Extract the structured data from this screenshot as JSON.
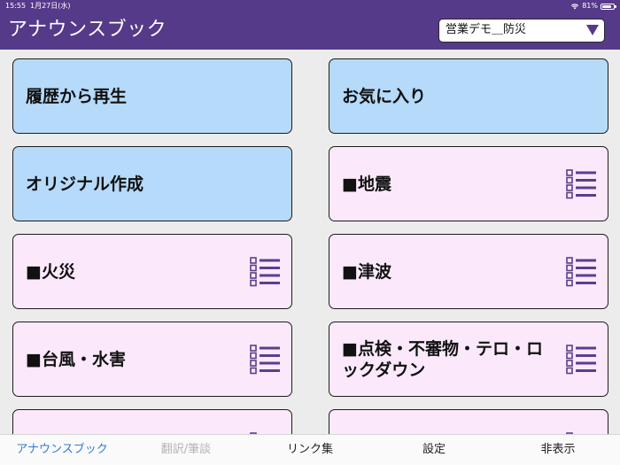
{
  "status_bar": {
    "time": "15:55",
    "date": "1月27日(水)",
    "battery_percent": "81%",
    "battery_level": 0.81
  },
  "header": {
    "title": "アナウンスブック",
    "scenario_select": {
      "value": "営業デモ＿防災"
    }
  },
  "cards": [
    {
      "label": "履歴から再生",
      "style": "blue",
      "has_list_icon": false
    },
    {
      "label": "お気に入り",
      "style": "blue",
      "has_list_icon": false
    },
    {
      "label": "オリジナル作成",
      "style": "blue",
      "has_list_icon": false
    },
    {
      "label": "■地震",
      "style": "pink",
      "has_list_icon": true
    },
    {
      "label": "■火災",
      "style": "pink",
      "has_list_icon": true
    },
    {
      "label": "■津波",
      "style": "pink",
      "has_list_icon": true
    },
    {
      "label": "■台風・水害",
      "style": "pink",
      "has_list_icon": true
    },
    {
      "label": "■点検・不審物・テロ・ロックダウン",
      "style": "pink",
      "has_list_icon": true
    },
    {
      "label": "",
      "style": "pink",
      "has_list_icon": true
    },
    {
      "label": "",
      "style": "pink",
      "has_list_icon": true
    }
  ],
  "tab_bar": {
    "tabs": [
      {
        "label": "アナウンスブック",
        "state": "active"
      },
      {
        "label": "翻訳/筆談",
        "state": "disabled"
      },
      {
        "label": "リンク集",
        "state": "normal"
      },
      {
        "label": "設定",
        "state": "normal"
      },
      {
        "label": "非表示",
        "state": "normal"
      }
    ]
  },
  "colors": {
    "header_bg": "#553a8a",
    "card_blue": "#b6daf9",
    "card_pink": "#fbe9fb",
    "icon_purple": "#5a3f8e",
    "tab_active": "#2e7ad6",
    "tab_disabled": "#b4b4b4"
  },
  "icons": {
    "list_icon": "list-icon",
    "dropdown_caret": "caret-down-icon"
  }
}
